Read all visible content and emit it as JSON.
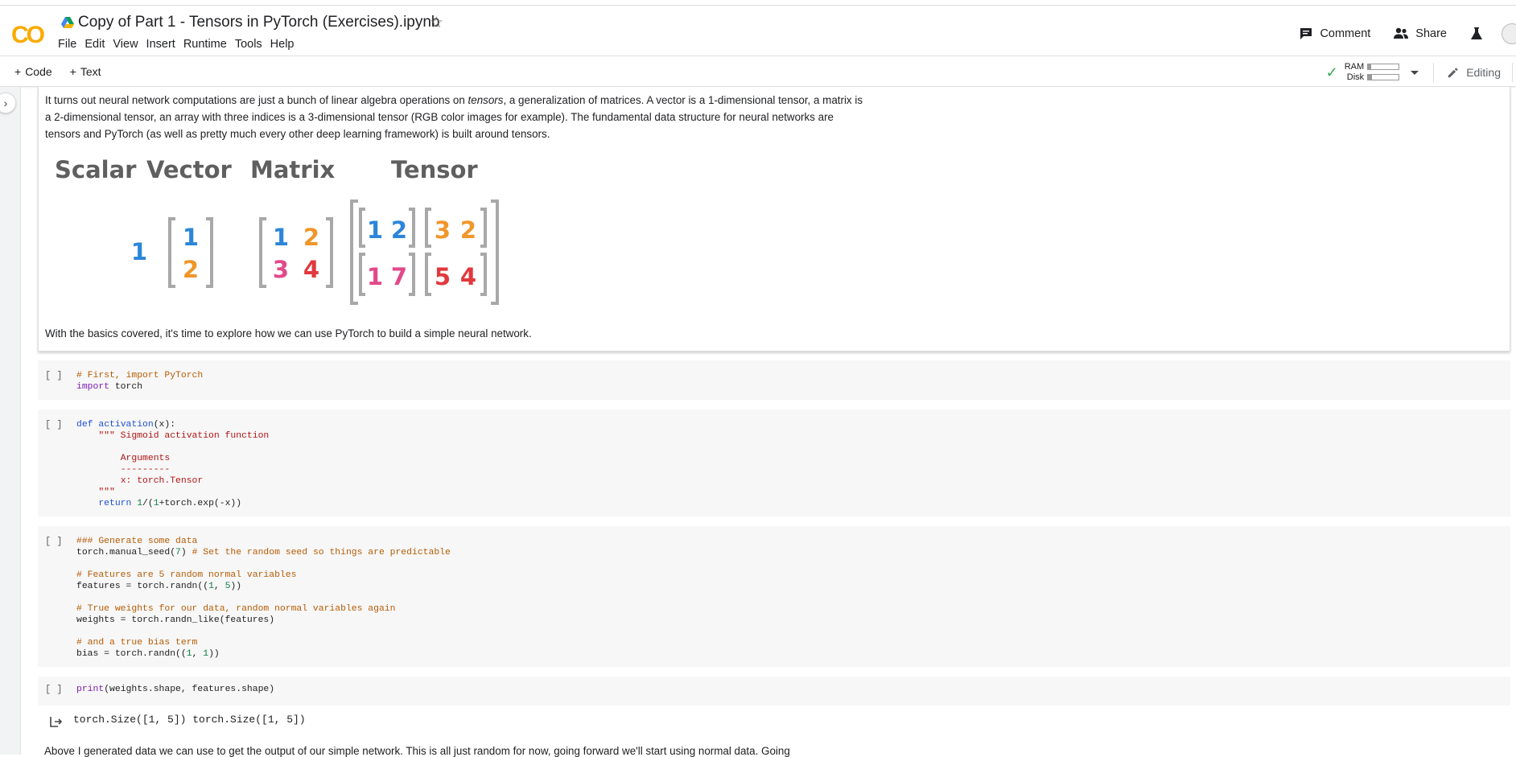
{
  "app": {
    "logo": "CO",
    "notebook_title": "Copy of Part 1 - Tensors in PyTorch (Exercises).ipynb"
  },
  "menu": [
    "File",
    "Edit",
    "View",
    "Insert",
    "Runtime",
    "Tools",
    "Help"
  ],
  "header_actions": {
    "comment_label": "Comment",
    "share_label": "Share"
  },
  "toolbar": {
    "add_code_label": "Code",
    "add_text_label": "Text",
    "ram_label": "RAM",
    "disk_label": "Disk",
    "ram_usage": 0.1,
    "disk_usage": 0.12,
    "editing_label": "Editing"
  },
  "text_cell": {
    "paragraph_pre": "It turns out neural network computations are just a bunch of linear algebra operations on ",
    "paragraph_em": "tensors",
    "paragraph_post": ", a generalization of matrices. A vector is a 1-dimensional tensor, a matrix is a 2-dimensional tensor, an array with three indices is a 3-dimensional tensor (RGB color images for example). The fundamental data structure for neural networks are tensors and PyTorch (as well as pretty much every other deep learning framework) is built around tensors.",
    "figure": {
      "labels": [
        "Scalar",
        "Vector",
        "Matrix",
        "Tensor"
      ],
      "scalar": "1",
      "vector": [
        "1",
        "2"
      ],
      "matrix": [
        "1",
        "2",
        "3",
        "4"
      ],
      "tensor_left": [
        "1",
        "2",
        "1",
        "7"
      ],
      "tensor_right": [
        "3",
        "2",
        "5",
        "4"
      ],
      "colors": {
        "blue": "#2b86d9",
        "orange": "#f0962a",
        "pink": "#e2498a",
        "red": "#e0393e",
        "label": "#5f5f5f",
        "bracket": "#a8a8a8"
      }
    },
    "closing": "With the basics covered, it's time to explore how we can use PyTorch to build a simple neural network."
  },
  "cells": {
    "run_indicator": "[ ]",
    "c1": {
      "l1": "# First, import PyTorch",
      "l2_kw": "import",
      "l2_rest": " torch"
    },
    "c2": {
      "def": "def",
      "fname": "activation",
      "sig": "(x):",
      "doc1": "\"\"\" Sigmoid activation function",
      "doc2": "Arguments",
      "doc3": "---------",
      "doc4": "x: torch.Tensor",
      "doc5": "\"\"\"",
      "ret": "return",
      "one": "1",
      "paren": "/(",
      "one2": "1",
      "rest": "+torch.exp(-x))"
    },
    "c3": {
      "l1": "### Generate some data",
      "l2a": "torch.manual_seed(",
      "l2n": "7",
      "l2b": ") ",
      "l2c": "# Set the random seed so things are predictable",
      "l3": "# Features are 5 random normal variables",
      "l4a": "features = torch.randn((",
      "l4n1": "1",
      "l4m": ", ",
      "l4n2": "5",
      "l4b": "))",
      "l5": "# True weights for our data, random normal variables again",
      "l6": "weights = torch.randn_like(features)",
      "l7": "# and a true bias term",
      "l8a": "bias = torch.randn((",
      "l8n1": "1",
      "l8m": ", ",
      "l8n2": "1",
      "l8b": "))"
    },
    "c4": {
      "fn": "print",
      "rest": "(weights.shape, features.shape)"
    },
    "output": "torch.Size([1, 5]) torch.Size([1, 5])"
  },
  "bottom_text": "Above I generated data we can use to get the output of our simple network. This is all just random for now, going forward we'll start using normal data. Going"
}
